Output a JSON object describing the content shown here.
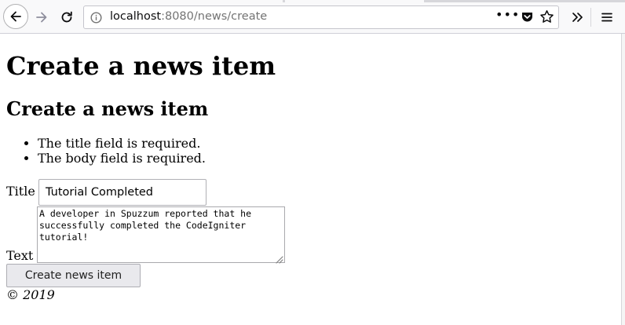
{
  "browser": {
    "url_host": "localhost",
    "url_rest": ":8080/news/create"
  },
  "page": {
    "heading": "Create a news item",
    "subheading": "Create a news item",
    "errors": [
      "The title field is required.",
      "The body field is required."
    ],
    "form": {
      "title_label": "Title",
      "title_value": "Tutorial Completed",
      "text_label": "Text",
      "text_value": "A developer in Spuzzum reported that he successfully completed the CodeIgniter tutorial!",
      "submit_label": "Create news item"
    },
    "footer": "© 2019"
  }
}
